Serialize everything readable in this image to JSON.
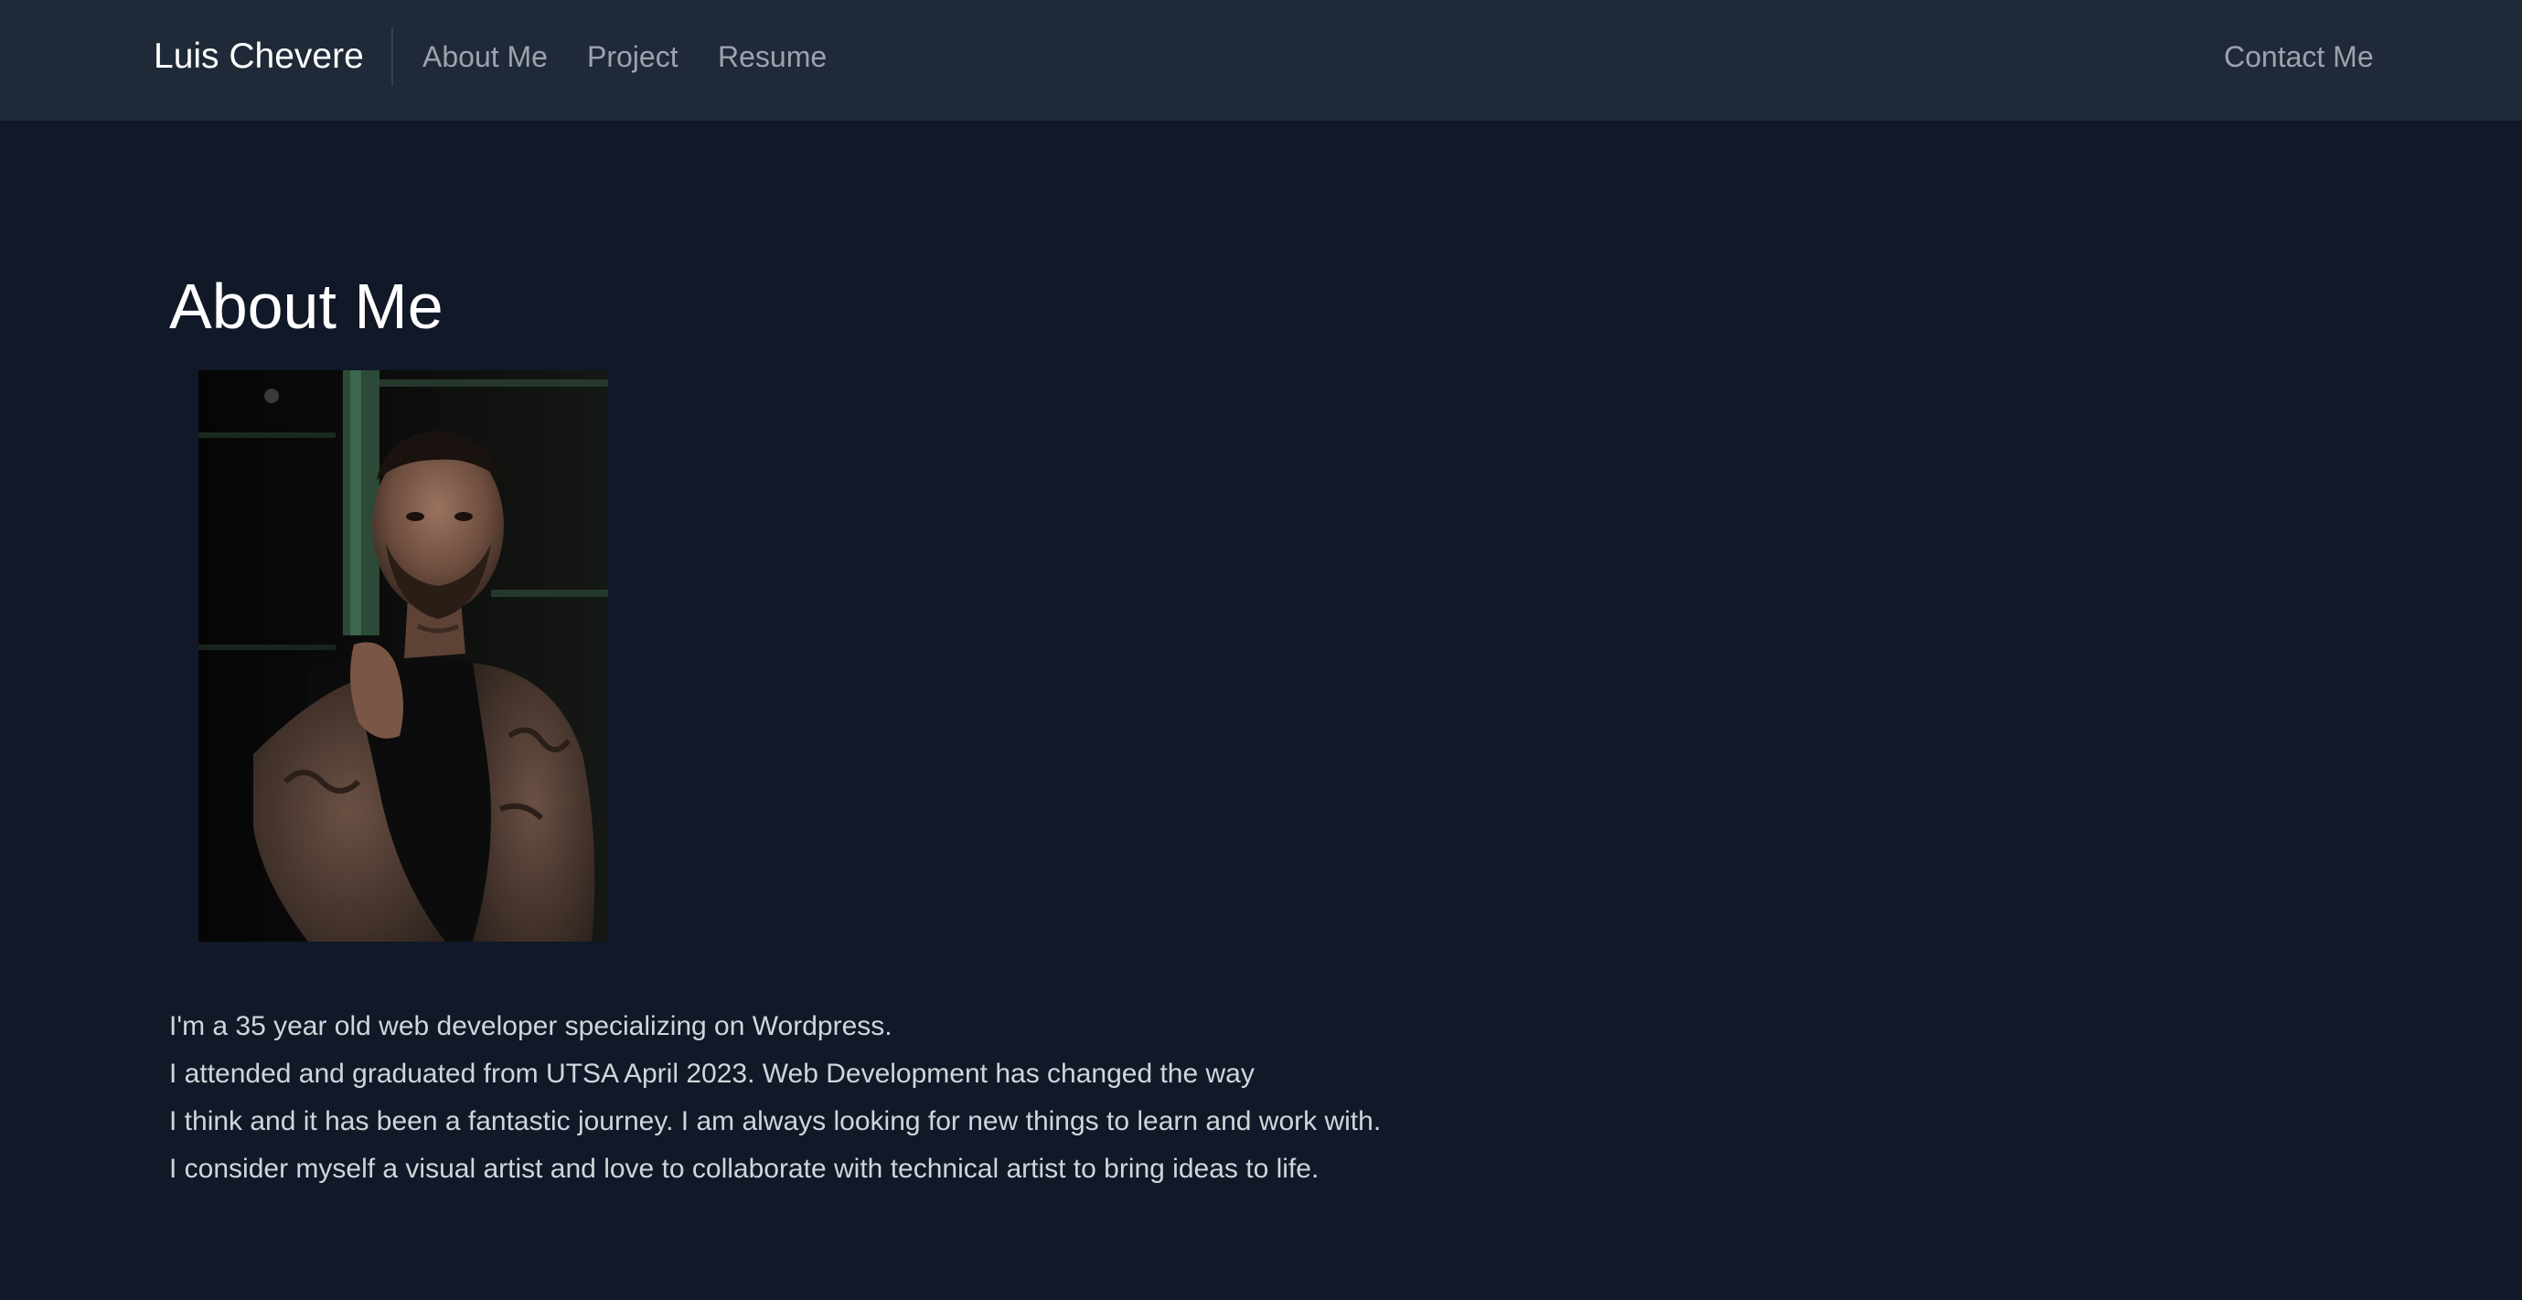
{
  "nav": {
    "brand": "Luis Chevere",
    "links": [
      {
        "label": "About Me"
      },
      {
        "label": "Project"
      },
      {
        "label": "Resume"
      }
    ],
    "contact_label": "Contact Me"
  },
  "main": {
    "title": "About Me",
    "bio_lines": [
      "I'm a 35 year old web developer specializing on Wordpress.",
      "I attended and graduated from UTSA April 2023. Web Development has changed the way",
      "I think and it has been a fantastic journey. I am always looking for new things to learn and work with.",
      "I consider myself a visual artist and love to collaborate with technical artist to bring ideas to life."
    ]
  },
  "colors": {
    "page_background": "#111827",
    "navbar_background": "#1f2937",
    "nav_text": "#9ca3af",
    "heading_text": "#ffffff",
    "body_text": "#d1d5db"
  }
}
